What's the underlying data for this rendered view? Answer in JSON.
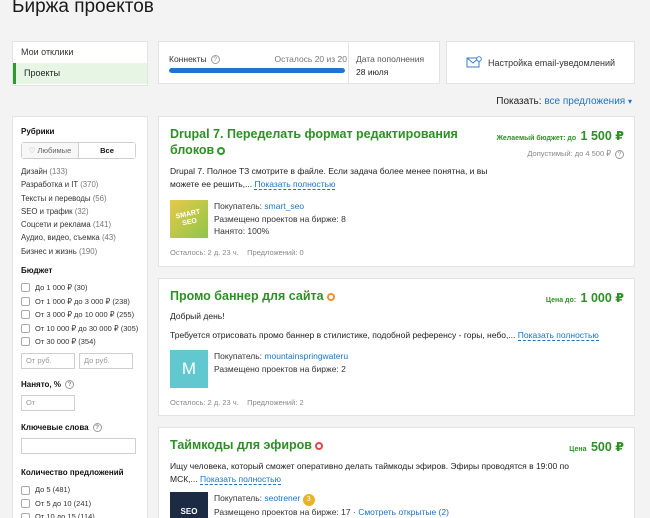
{
  "page": {
    "title": "Биржа проектов"
  },
  "nav": {
    "items": [
      {
        "label": "Мои отклики",
        "active": false
      },
      {
        "label": "Проекты",
        "active": true
      }
    ]
  },
  "connects": {
    "label": "Коннекты",
    "remaining": "Осталось 20 из 20",
    "progress": 1.0,
    "date_label": "Дата пополнения",
    "date_value": "28 июля"
  },
  "email_settings": {
    "label": "Настройка email-уведомлений"
  },
  "show": {
    "label": "Показать:",
    "value": "все предложения"
  },
  "filters": {
    "rubrics": {
      "title": "Рубрики",
      "toggle_favorites": "Любимые",
      "toggle_all": "Все",
      "items": [
        {
          "name": "Дизайн",
          "count": "(133)"
        },
        {
          "name": "Разработка и IT",
          "count": "(370)"
        },
        {
          "name": "Тексты и переводы",
          "count": "(56)"
        },
        {
          "name": "SEO и трафик",
          "count": "(32)"
        },
        {
          "name": "Соцсети и реклама",
          "count": "(141)"
        },
        {
          "name": "Аудио, видео, съемка",
          "count": "(43)"
        },
        {
          "name": "Бизнес и жизнь",
          "count": "(190)"
        }
      ]
    },
    "budget": {
      "title": "Бюджет",
      "items": [
        {
          "label": "До 1 000 ₽",
          "count": "(30)"
        },
        {
          "label": "От 1 000 ₽ до 3 000 ₽",
          "count": "(238)"
        },
        {
          "label": "От 3 000 ₽ до 10 000 ₽",
          "count": "(255)"
        },
        {
          "label": "От 10 000 ₽ до 30 000 ₽",
          "count": "(305)"
        },
        {
          "label": "От 30 000 ₽",
          "count": "(354)"
        }
      ],
      "from_placeholder": "От руб.",
      "to_placeholder": "До руб."
    },
    "hired": {
      "title": "Нанято, %",
      "placeholder": "От"
    },
    "keywords": {
      "title": "Ключевые слова"
    },
    "offers": {
      "title": "Количество предложений",
      "items": [
        {
          "label": "До 5",
          "count": "(481)"
        },
        {
          "label": "От 5 до 10",
          "count": "(241)"
        },
        {
          "label": "От 10 до 15",
          "count": "(114)"
        },
        {
          "label": "От 15 до 20",
          "count": "(70)"
        }
      ]
    }
  },
  "projects": [
    {
      "title": "Drupal 7. Переделать формат редактирования блоков",
      "price_label": "Желаемый бюджет: до",
      "price": "1 500 ₽",
      "allowed_label": "Допустимый: до 4 500 ₽",
      "description": "Drupal 7. Полное ТЗ смотрите в файле. Если задача более менее понятна, и вы можете ее решить,...",
      "show_full": "Показать полностью",
      "avatar_text": "SMART SEO",
      "buyer_label": "Покупатель:",
      "buyer_name": "smart_seo",
      "placed_label": "Размещено проектов на бирже: 8",
      "hired_label": "Нанято: 100%",
      "meta": "Осталось: 2 д. 23 ч.    Предложений: 0",
      "badge_color": "#2e9a2e"
    },
    {
      "title": "Промо баннер для сайта",
      "price_label": "Цена до:",
      "price": "1 000 ₽",
      "description_line1": "Добрый день!",
      "description": "Требуется отрисовать промо баннер в стилистике, подобной референсу - горы, небо,...",
      "show_full": "Показать полностью",
      "avatar_text": "M",
      "buyer_label": "Покупатель:",
      "buyer_name": "mountainspringwateru",
      "placed_label": "Размещено проектов на бирже: 2",
      "meta": "Осталось: 2 д. 23 ч.    Предложений: 2",
      "badge_color": "#f0902a"
    },
    {
      "title": "Таймкоды для эфиров",
      "price_label": "Цена",
      "price": "500 ₽",
      "description": "Ищу человека, который сможет оперативно делать таймкоды эфиров. Эфиры проводятся в 19:00 по МСК,...",
      "show_full": "Показать полностью",
      "avatar_text": "SEO",
      "buyer_label": "Покупатель:",
      "buyer_name": "seotrener",
      "buyer_level": "3",
      "placed_label": "Размещено проектов на бирже: 17",
      "open_link": "Смотреть открытые (2)",
      "badge_color": "#e04848"
    }
  ]
}
